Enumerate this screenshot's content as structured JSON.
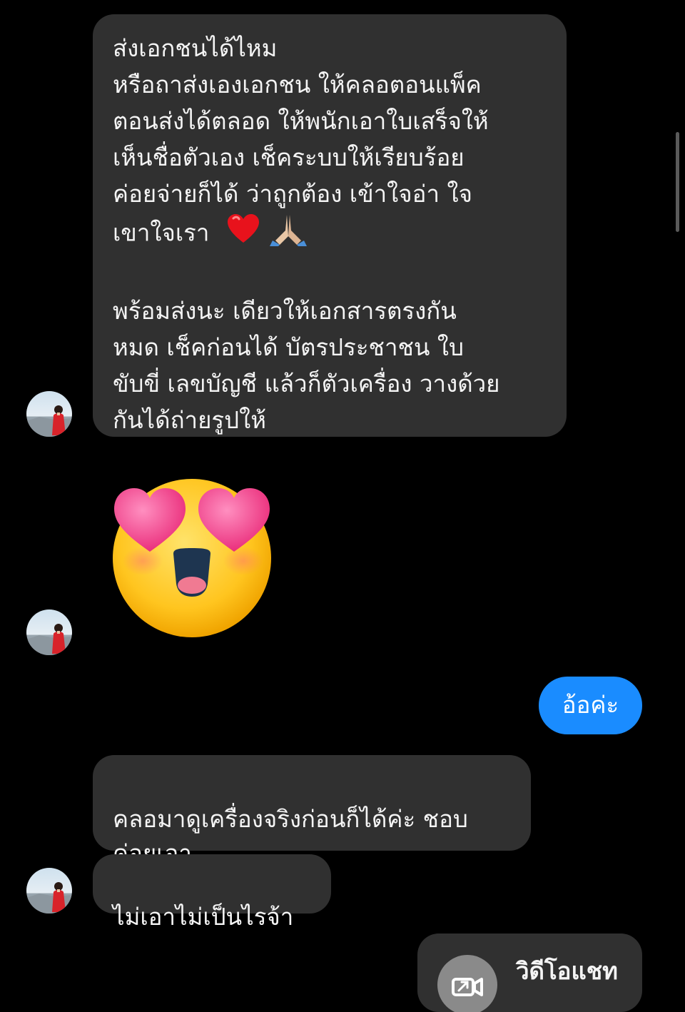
{
  "messages": {
    "m1": {
      "line1": "ส่งเอกชนได้ไหม",
      "line2": "หรือถาส่งเองเอกชน ให้คลอตอนแพ็ค",
      "line3": "ตอนส่งได้ตลอด ให้พนักเอาใบเสร็จให้",
      "line4": "เห็นชื่อตัวเอง เช็คระบบให้เรียบร้อย",
      "line5": "ค่อยจ่ายก็ได้ ว่าถูกต้อง เข้าใจอ่า ใจ",
      "line6": "เขาใจเรา",
      "emoji_heart": "❤️",
      "emoji_pray": "🙏🏼",
      "line7": "พร้อมส่งนะ เดียวให้เอกสารตรงกัน",
      "line8": "หมด เช็คก่อนได้ บัตรประชาชน ใบ",
      "line9": "ขับขี่ เลขบัญชี แล้วก็ตัวเครื่อง วางด้วย",
      "line10": "กันได้ถ่ายรูปให้"
    },
    "m3": "อ้อค่ะ",
    "m4": "คลอมาดูเครื่องจริงก่อนก็ได้ค่ะ ชอบ\nค่อยเอา",
    "m5": "ไม่เอาไม่เป็นไรจ้า",
    "video_chat_label": "วิดีโอแชท"
  },
  "colors": {
    "background": "#000000",
    "incoming_bubble": "#303030",
    "outgoing_bubble": "#1a8cff"
  },
  "icons": {
    "big_emoji": "heart-eyes-face-icon",
    "video": "video-camera-icon"
  }
}
